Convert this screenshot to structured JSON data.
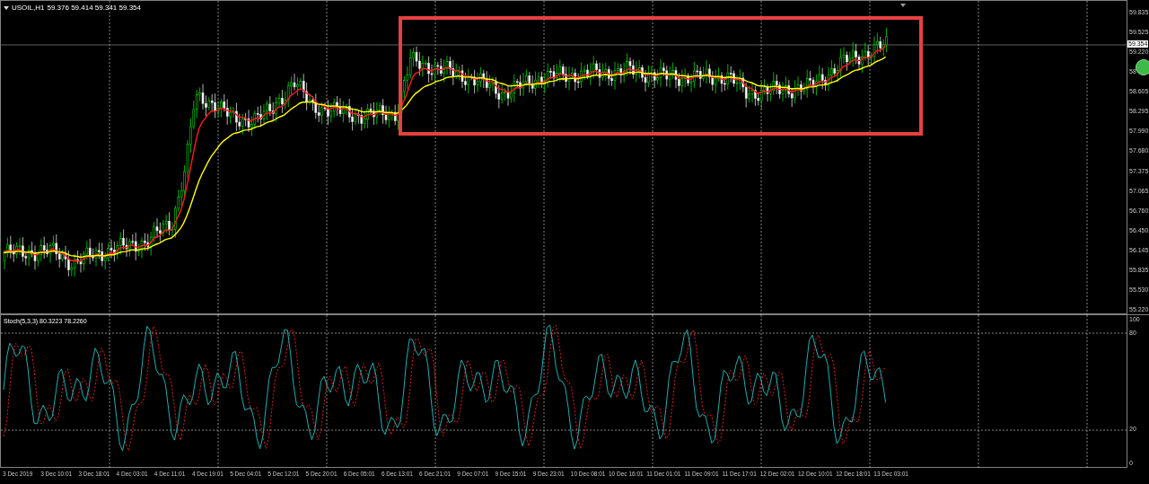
{
  "chart": {
    "symbol": "USOIL,H1",
    "ohlc": "59.376 59.414 59.341 59.354",
    "current_price": "59.354",
    "price_ticks": [
      "59.835",
      "59.525",
      "59.220",
      "58",
      "58.605",
      "58.295",
      "57.990",
      "57.680",
      "57.375",
      "57.065",
      "56.760",
      "56.450",
      "56.145",
      "55.835",
      "55.530",
      "55.220"
    ]
  },
  "stochastic": {
    "title": "Stoch(5,3,3) 80.3223 78.2260",
    "levels": [
      "100",
      "80",
      "20",
      "0"
    ]
  },
  "time_axis": [
    "3 Dec 2019",
    "3 Dec 10:01",
    "3 Dec 18:01",
    "4 Dec 03:01",
    "4 Dec 11:01",
    "4 Dec 19:01",
    "5 Dec 04:01",
    "5 Dec 12:01",
    "5 Dec 20:01",
    "6 Dec 05:01",
    "6 Dec 13:01",
    "6 Dec 21:01",
    "9 Dec 07:01",
    "9 Dec 15:01",
    "9 Dec 23:01",
    "10 Dec 08:01",
    "10 Dec 16:01",
    "11 Dec 01:01",
    "11 Dec 09:01",
    "11 Dec 17:01",
    "12 Dec 02:01",
    "12 Dec 10:01",
    "12 Dec 18:01",
    "13 Dec 03:01"
  ]
}
